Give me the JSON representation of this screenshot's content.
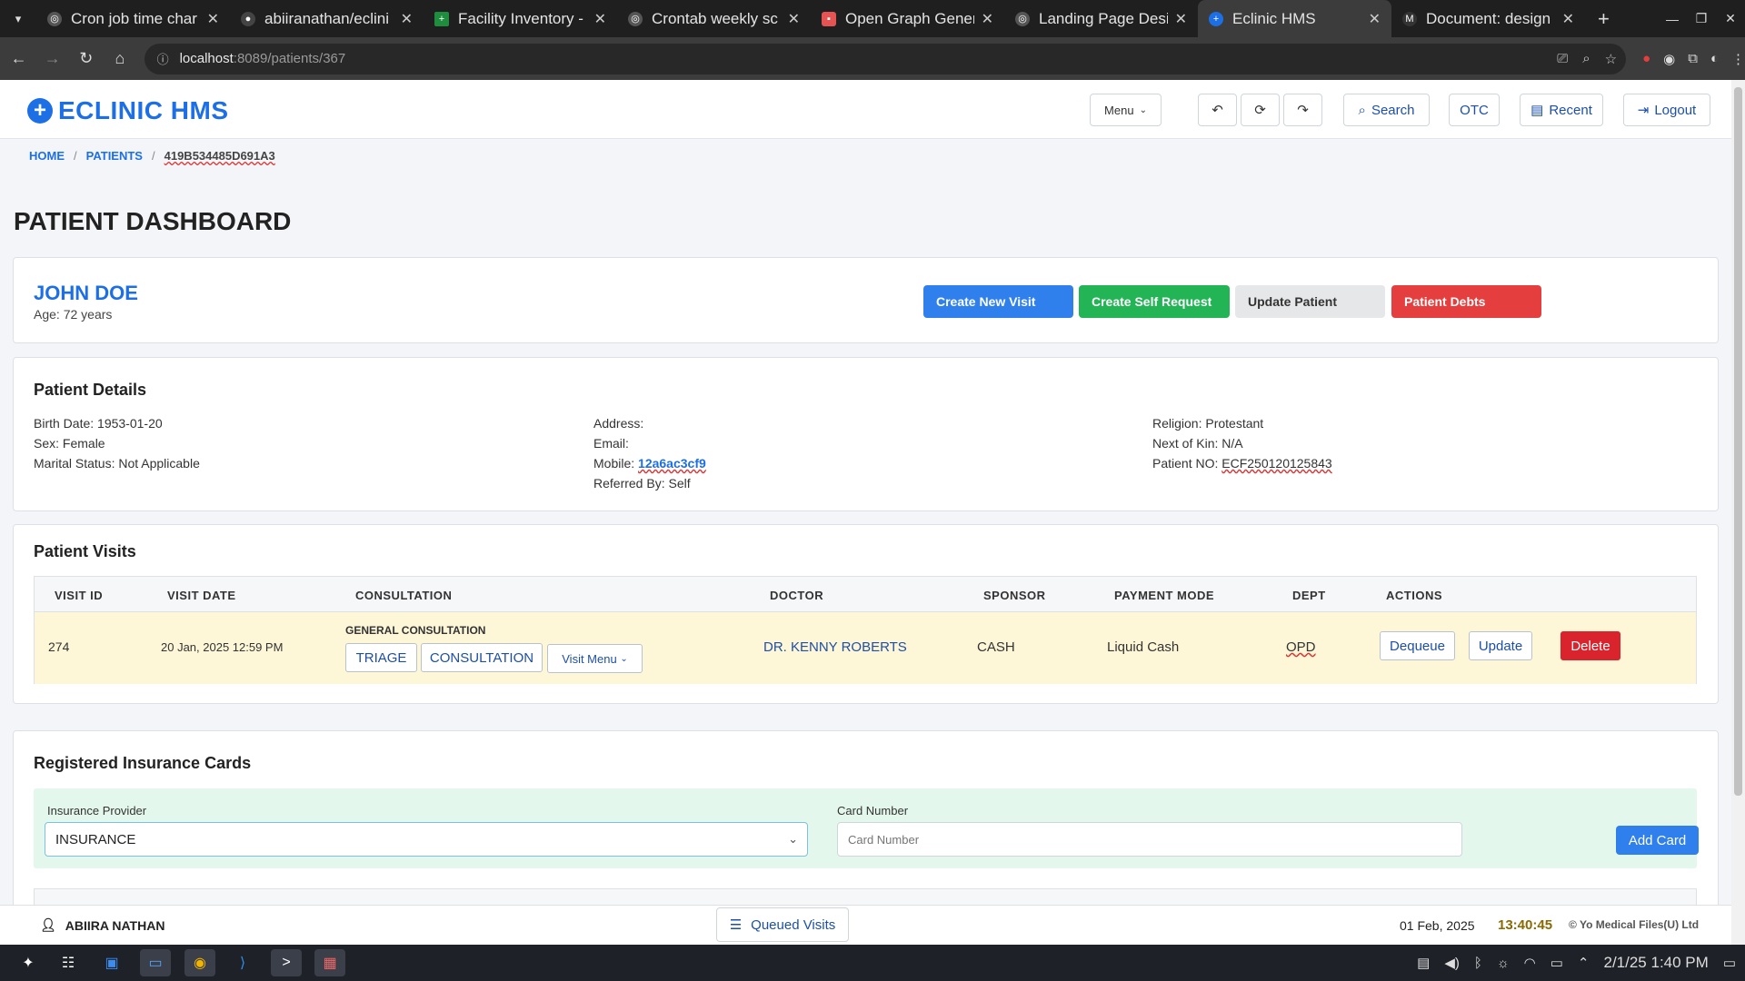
{
  "browser": {
    "tabs": [
      {
        "title": "Cron job time char",
        "icon": "cron-icon",
        "color": "#555555"
      },
      {
        "title": "abiiranathan/eclini",
        "icon": "github-icon",
        "color": "#333333"
      },
      {
        "title": "Facility Inventory -",
        "icon": "sheets-icon",
        "color": "#1e8e3e"
      },
      {
        "title": "Crontab weekly sc",
        "icon": "cron-icon",
        "color": "#555555"
      },
      {
        "title": "Open Graph Gener",
        "icon": "og-icon",
        "color": "#e55353"
      },
      {
        "title": "Landing Page Desi",
        "icon": "chatgpt-icon",
        "color": "#555555"
      },
      {
        "title": "Eclinic HMS",
        "icon": "eclinic-icon",
        "color": "#1d6fe5"
      },
      {
        "title": "Document: design",
        "icon": "doc-icon",
        "color": "#333333"
      }
    ],
    "url_host": "localhost",
    "url_path": ":8089/patients/367"
  },
  "header": {
    "logo_text": "ECLINIC HMS",
    "menu_label": "Menu",
    "search_label": "Search",
    "otc_label": "OTC",
    "recent_label": "Recent",
    "logout_label": "Logout"
  },
  "breadcrumb": {
    "home": "HOME",
    "patients": "PATIENTS",
    "current": "419B534485D691A3"
  },
  "page_title": "PATIENT DASHBOARD",
  "patient": {
    "name": "JOHN DOE",
    "age": "Age: 72 years",
    "actions": {
      "create_visit": "Create New Visit",
      "self_request": "Create Self Request",
      "update": "Update Patient",
      "debts": "Patient Debts"
    },
    "colors": {
      "primary": "#2f80ed",
      "success": "#22b455",
      "secondary": "#e6e7e9",
      "danger": "#e53e3e"
    }
  },
  "details": {
    "title": "Patient Details",
    "birth_date": "Birth Date: 1953-01-20",
    "sex": "Sex: Female",
    "marital": "Marital Status: Not Applicable",
    "address": "Address:",
    "email": "Email:",
    "mobile_label": "Mobile:",
    "mobile_value": "12a6ac3cf9",
    "referred": "Referred By: Self",
    "religion": "Religion: Protestant",
    "next_of_kin": "Next of Kin: N/A",
    "patient_no_label": "Patient NO:",
    "patient_no_value": "ECF250120125843"
  },
  "visits": {
    "title": "Patient Visits",
    "headers": [
      "VISIT ID",
      "VISIT DATE",
      "CONSULTATION",
      "DOCTOR",
      "SPONSOR",
      "PAYMENT MODE",
      "DEPT",
      "ACTIONS"
    ],
    "row": {
      "id": "274",
      "date": "20 Jan, 2025 12:59 PM",
      "consultation": "GENERAL CONSULTATION",
      "triage": "TRIAGE",
      "consult_btn": "CONSULTATION",
      "visit_menu": "Visit Menu",
      "doctor": "DR. KENNY ROBERTS",
      "sponsor": "CASH",
      "payment": "Liquid Cash",
      "dept": "OPD",
      "dequeue": "Dequeue",
      "update": "Update",
      "delete": "Delete"
    }
  },
  "insurance": {
    "title": "Registered Insurance Cards",
    "provider_label": "Insurance Provider",
    "provider_value": "INSURANCE",
    "card_label": "Card Number",
    "card_placeholder": "Card Number",
    "add_card": "Add Card"
  },
  "footer": {
    "user": "ABIIRA NATHAN",
    "queued": "Queued Visits",
    "date": "01 Feb, 2025",
    "time": "13:40:45",
    "copyright": "© Yo Medical Files(U) Ltd"
  },
  "taskbar": {
    "clock": "2/1/25 1:40 PM"
  }
}
